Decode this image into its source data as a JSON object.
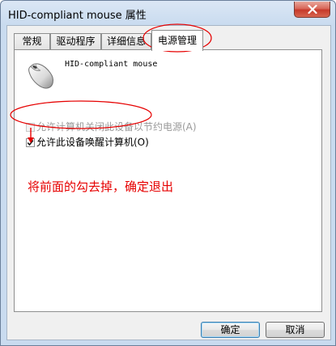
{
  "window": {
    "title": "HID-compliant mouse 属性"
  },
  "tabs": [
    {
      "label": "常规"
    },
    {
      "label": "驱动程序"
    },
    {
      "label": "详细信息"
    },
    {
      "label": "电源管理"
    }
  ],
  "device": {
    "name": "HID-compliant mouse",
    "icon": "mouse-icon"
  },
  "options": {
    "allow_power_off": {
      "label": "允许计算机关闭此设备以节约电源(A)",
      "checked": false,
      "enabled": false
    },
    "allow_wake": {
      "label": "允许此设备唤醒计算机(O)",
      "checked": true,
      "enabled": true
    }
  },
  "annotation": {
    "text": "将前面的勾去掉，确定退出",
    "color": "#e60000"
  },
  "buttons": {
    "ok": "确定",
    "cancel": "取消"
  },
  "colors": {
    "annotation_red": "#e60000",
    "close_button": "#c6392a"
  }
}
